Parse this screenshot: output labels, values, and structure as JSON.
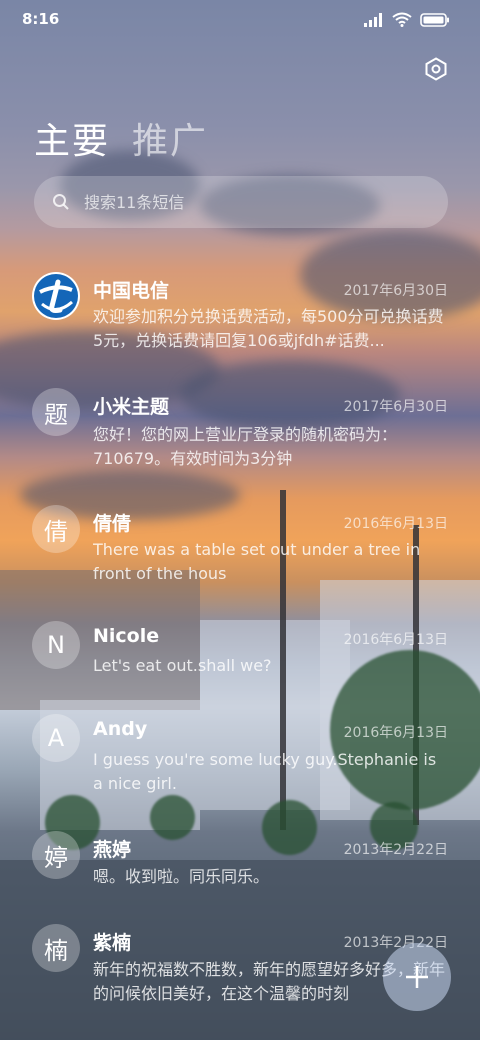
{
  "status_bar": {
    "time": "8:16"
  },
  "tabs": [
    {
      "label": "主要",
      "active": true
    },
    {
      "label": "推广",
      "active": false
    }
  ],
  "search": {
    "placeholder": "搜索11条短信"
  },
  "messages": [
    {
      "sender": "中国电信",
      "date": "2017年6月30日",
      "preview": "欢迎参加积分兑换话费活动，每500分可兑换话费5元，兑换话费请回复106或jfdh#话费...",
      "avatar": ""
    },
    {
      "sender": "小米主题",
      "date": "2017年6月30日",
      "preview": "您好！您的网上营业厅登录的随机密码为：710679。有效时间为3分钟",
      "avatar": "题"
    },
    {
      "sender": "倩倩",
      "date": "2016年6月13日",
      "preview": "There was a table set out under a tree in front of the hous",
      "avatar": "倩"
    },
    {
      "sender": "Nicole",
      "date": "2016年6月13日",
      "preview": "Let's eat out.shall we?",
      "avatar": "N"
    },
    {
      "sender": "Andy",
      "date": "2016年6月13日",
      "preview": "I guess you're some lucky guy.Stephanie is a nice girl.",
      "avatar": "A"
    },
    {
      "sender": "燕婷",
      "date": "2013年2月22日",
      "preview": "嗯。收到啦。同乐同乐。",
      "avatar": "婷"
    },
    {
      "sender": "紫楠",
      "date": "2013年2月22日",
      "preview": "新年的祝福数不胜数，新年的愿望好多好多，新年的问候依旧美好，在这个温馨的时刻",
      "avatar": "楠"
    }
  ],
  "colors": {
    "china_telecom_blue": "#1466b8"
  },
  "icons": {
    "settings": "settings-icon",
    "search": "search-icon",
    "compose": "plus-icon"
  }
}
